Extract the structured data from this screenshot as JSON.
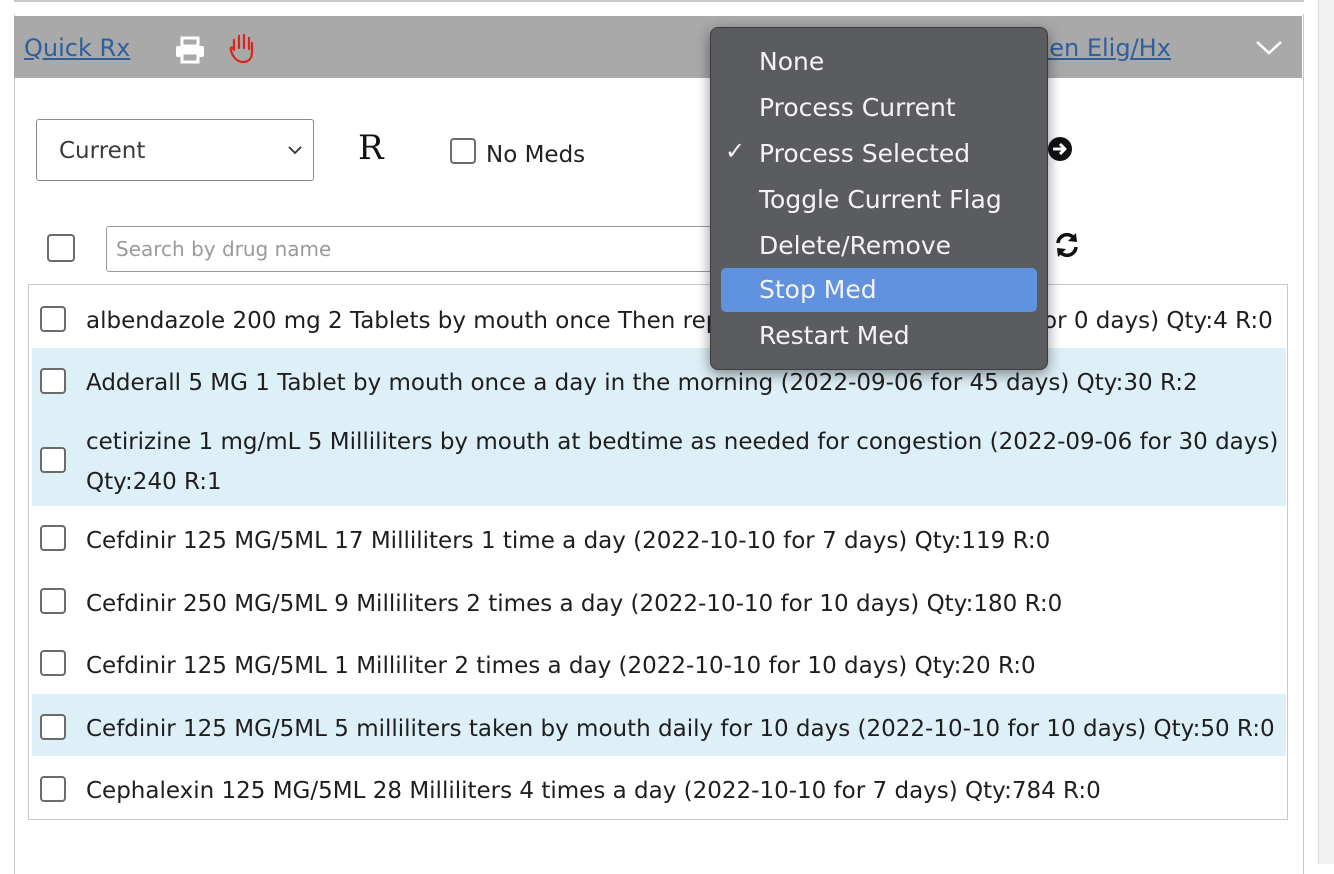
{
  "header": {
    "quick_rx": "Quick Rx",
    "elig_link": "pen Elig/Hx"
  },
  "filter": {
    "selected": "Current",
    "r_label": "R",
    "no_meds_label": "No Meds"
  },
  "search": {
    "placeholder": "Search by drug name"
  },
  "menu": {
    "items": [
      "None",
      "Process Current",
      "Process Selected",
      "Toggle Current Flag",
      "Delete/Remove",
      "Stop Med",
      "Restart Med"
    ],
    "checked": "Process Selected",
    "highlighted": "Stop Med"
  },
  "meds": [
    {
      "text": "albendazole 200 mg 2 Tablets by mouth once Then rep",
      "tail": "or 0 days) Qty:4 R:0"
    },
    {
      "text": "Adderall 5 MG 1 Tablet by mouth once a day in the morning (2022-09-06 for 45 days) Qty:30 R:2"
    },
    {
      "text": "cetirizine 1 mg/mL 5 Milliliters by mouth at bedtime as needed for congestion (2022-09-06 for 30 days)",
      "line2": "Qty:240 R:1"
    },
    {
      "text": "Cefdinir 125 MG/5ML 17 Milliliters 1 time a day (2022-10-10 for 7 days) Qty:119 R:0"
    },
    {
      "text": "Cefdinir 250 MG/5ML 9 Milliliters 2 times a day (2022-10-10 for 10 days) Qty:180 R:0"
    },
    {
      "text": "Cefdinir 125 MG/5ML 1 Milliliter 2 times a day (2022-10-10 for 10 days) Qty:20 R:0"
    },
    {
      "text": "Cefdinir 125 MG/5ML 5 milliliters taken by mouth daily for 10 days (2022-10-10 for 10 days) Qty:50 R:0"
    },
    {
      "text": "Cephalexin 125 MG/5ML 28 Milliliters 4 times a day (2022-10-10 for 7 days) Qty:784 R:0"
    }
  ],
  "colors": {
    "header_bg": "#a9a9a9",
    "link": "#2e5f9e",
    "row_highlight": "#def0f7",
    "menu_bg": "#5b5c5f",
    "menu_selected": "#6192e0"
  }
}
